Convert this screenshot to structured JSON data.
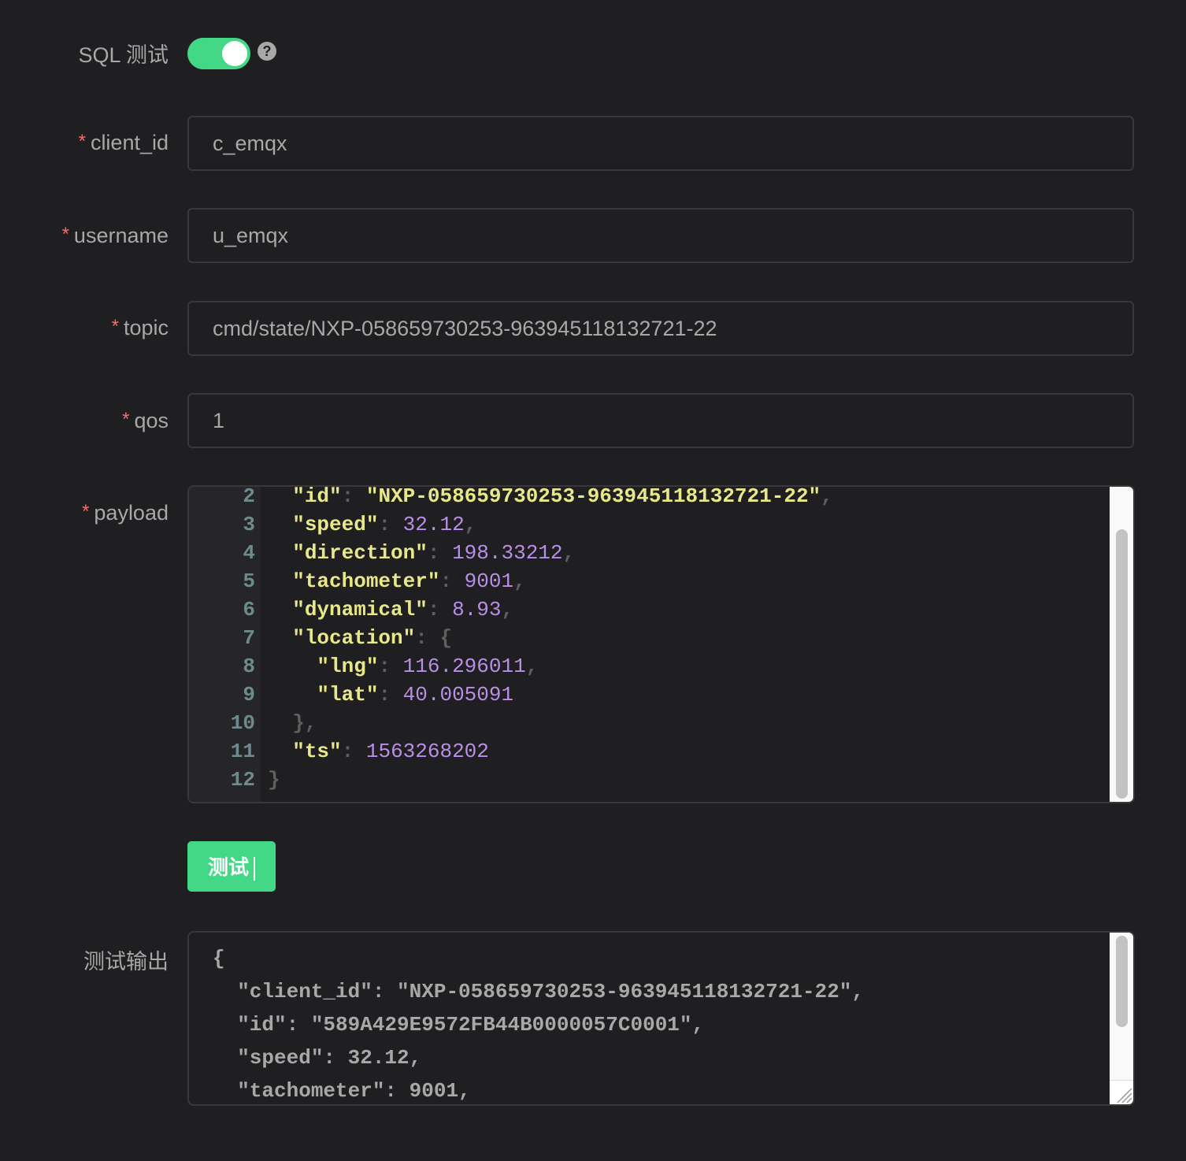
{
  "sql_test": {
    "label": "SQL 测试",
    "enabled": true,
    "help_icon": "question-circle-icon",
    "help_glyph": "?"
  },
  "fields": {
    "required_mark": "*",
    "client_id": {
      "label": "client_id",
      "value": "c_emqx"
    },
    "username": {
      "label": "username",
      "value": "u_emqx"
    },
    "topic": {
      "label": "topic",
      "value": "cmd/state/NXP-058659730253-963945118132721-22"
    },
    "qos": {
      "label": "qos",
      "value": "1"
    },
    "payload": {
      "label": "payload",
      "lines": [
        {
          "num": "2",
          "indent": "  ",
          "key": "\"id\"",
          "sep": ": ",
          "value": "\"NXP-058659730253-963945118132721-22\"",
          "value_type": "string",
          "tail": ","
        },
        {
          "num": "3",
          "indent": "  ",
          "key": "\"speed\"",
          "sep": ": ",
          "value": "32.12",
          "value_type": "number",
          "tail": ","
        },
        {
          "num": "4",
          "indent": "  ",
          "key": "\"direction\"",
          "sep": ": ",
          "value": "198.33212",
          "value_type": "number",
          "tail": ","
        },
        {
          "num": "5",
          "indent": "  ",
          "key": "\"tachometer\"",
          "sep": ": ",
          "value": "9001",
          "value_type": "number",
          "tail": ","
        },
        {
          "num": "6",
          "indent": "  ",
          "key": "\"dynamical\"",
          "sep": ": ",
          "value": "8.93",
          "value_type": "number",
          "tail": ","
        },
        {
          "num": "7",
          "indent": "  ",
          "key": "\"location\"",
          "sep": ": ",
          "value": "{",
          "value_type": "punct",
          "tail": ""
        },
        {
          "num": "8",
          "indent": "    ",
          "key": "\"lng\"",
          "sep": ": ",
          "value": "116.296011",
          "value_type": "number",
          "tail": ","
        },
        {
          "num": "9",
          "indent": "    ",
          "key": "\"lat\"",
          "sep": ": ",
          "value": "40.005091",
          "value_type": "number",
          "tail": ""
        },
        {
          "num": "10",
          "indent": "  ",
          "key": "",
          "sep": "",
          "value": "},",
          "value_type": "punct",
          "tail": ""
        },
        {
          "num": "11",
          "indent": "  ",
          "key": "\"ts\"",
          "sep": ": ",
          "value": "1563268202",
          "value_type": "number",
          "tail": ""
        },
        {
          "num": "12",
          "indent": "",
          "key": "",
          "sep": "",
          "value": "}",
          "value_type": "punct",
          "tail": ""
        }
      ],
      "scroll_position": 0.12
    }
  },
  "test_button": {
    "label": "测试"
  },
  "output": {
    "label": "测试输出",
    "text": "{\n  \"client_id\": \"NXP-058659730253-963945118132721-22\",\n  \"id\": \"589A429E9572FB44B0000057C0001\",\n  \"speed\": 32.12,\n  \"tachometer\": 9001,"
  }
}
